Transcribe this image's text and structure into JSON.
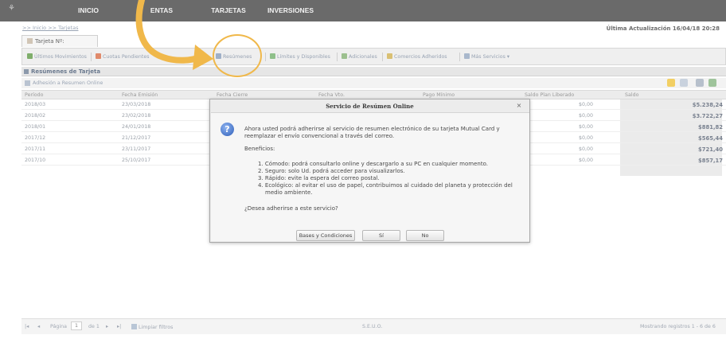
{
  "nav": {
    "tabs": [
      "INICIO",
      "ENTAS",
      "TARJETAS",
      "INVERSIONES"
    ]
  },
  "breadcrumb": ">> Inicio >> Tarjetas",
  "last_update": "Última Actualización 16/04/18 20:28",
  "card_tab": "Tarjeta Nº:",
  "toolbar": {
    "items": [
      "Últimos Movimientos",
      "Cuotas Pendientes",
      "Resúmenes",
      "Límites y Disponibles",
      "Adicionales",
      "Comercios Adheridos",
      "Más Servicios"
    ]
  },
  "section_title": "Resúmenes de Tarjeta",
  "sub_action": "Adhesión a Resumen Online",
  "table": {
    "headers": [
      "Período",
      "Fecha Emisión",
      "Fecha Cierre",
      "Fecha Vto.",
      "Pago Mínimo",
      "Saldo Plan Liberado",
      "Saldo"
    ],
    "rows": [
      {
        "period": "2018/03",
        "emision": "23/03/2018",
        "plan": "$0,00",
        "saldo": "$5.238,24"
      },
      {
        "period": "2018/02",
        "emision": "23/02/2018",
        "plan": "$0,00",
        "saldo": "$3.722,27"
      },
      {
        "period": "2018/01",
        "emision": "24/01/2018",
        "plan": "$0,00",
        "saldo": "$881,82"
      },
      {
        "period": "2017/12",
        "emision": "21/12/2017",
        "plan": "$0,00",
        "saldo": "$565,44"
      },
      {
        "period": "2017/11",
        "emision": "23/11/2017",
        "plan": "$0,00",
        "saldo": "$721,40"
      },
      {
        "period": "2017/10",
        "emision": "25/10/2017",
        "plan": "$0,00",
        "saldo": "$857,17"
      }
    ]
  },
  "footer": {
    "page_label": "Página",
    "page_value": "1",
    "of_label": "de 1",
    "clear_filters": "Limpiar filtros",
    "center": "S.E.U.O.",
    "records": "Mostrando registros 1 - 6 de 6"
  },
  "modal": {
    "title": "Servicio de Resúmen Online",
    "intro_1": "Ahora usted podrá adherirse al servicio de resumen electrónico de su tarjeta Mutual Card y",
    "intro_2": "reemplazar el envío convencional a través del correo.",
    "benefits_label": "Beneficios:",
    "benefit_1": "1. Cómodo: podrá consultarlo online y descargarlo a su PC en cualquier momento.",
    "benefit_2": "2. Seguro: solo Ud. podrá acceder para visualizarlos.",
    "benefit_3": "3. Rápido: evite la espera del correo postal.",
    "benefit_4a": "4. Ecológico: al evitar el uso de papel, contribuimos al cuidado del planeta y protección del",
    "benefit_4b": "medio ambiente.",
    "question": "¿Desea adherirse a este servicio?",
    "btn_terms": "Bases y Condiciones",
    "btn_yes": "Sí",
    "btn_no": "No",
    "close": "×"
  },
  "colors": {
    "topbar": "#6a6a6a",
    "annotation": "#f0b84a"
  }
}
